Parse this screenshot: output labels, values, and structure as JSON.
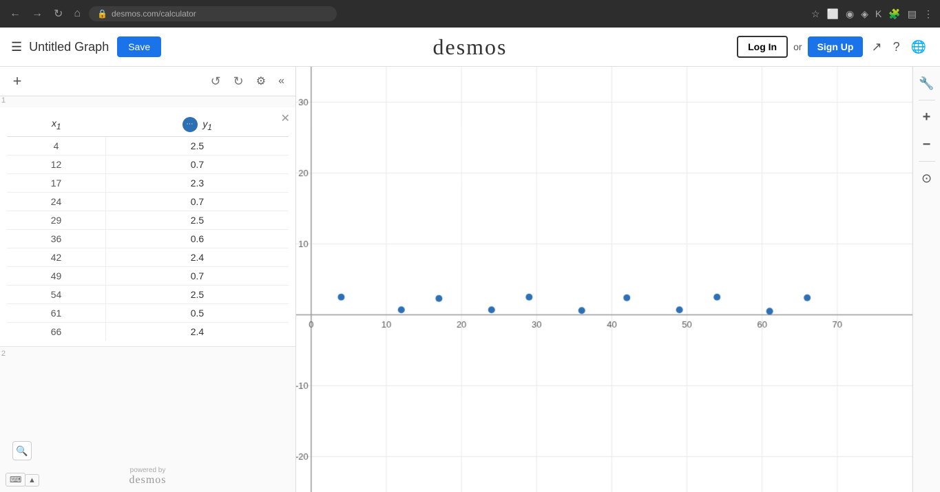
{
  "browser": {
    "url": "desmos.com/calculator",
    "back_icon": "←",
    "forward_icon": "→",
    "refresh_icon": "↻",
    "home_icon": "⌂"
  },
  "header": {
    "menu_icon": "☰",
    "title": "Untitled Graph",
    "save_label": "Save",
    "logo": "desmos",
    "login_label": "Log In",
    "or_text": "or",
    "signup_label": "Sign Up"
  },
  "sidebar": {
    "add_label": "+",
    "undo_label": "↺",
    "redo_label": "↻",
    "settings_label": "⚙",
    "collapse_label": "«",
    "table": {
      "col_x": "x₁",
      "col_y": "y₁",
      "rows": [
        {
          "x": "4",
          "y": "2.5"
        },
        {
          "x": "12",
          "y": "0.7"
        },
        {
          "x": "17",
          "y": "2.3"
        },
        {
          "x": "24",
          "y": "0.7"
        },
        {
          "x": "29",
          "y": "2.5"
        },
        {
          "x": "36",
          "y": "0.6"
        },
        {
          "x": "42",
          "y": "2.4"
        },
        {
          "x": "49",
          "y": "0.7"
        },
        {
          "x": "54",
          "y": "2.5"
        },
        {
          "x": "61",
          "y": "0.5"
        },
        {
          "x": "66",
          "y": "2.4"
        }
      ]
    },
    "keyboard_label": "⌨",
    "expand_label": "▲",
    "row_labels": [
      "1",
      "2"
    ],
    "powered_by": "powered by",
    "desmos_small": "desmos"
  },
  "graph": {
    "x_labels": [
      "0",
      "10",
      "20",
      "30",
      "40",
      "50",
      "60",
      "70"
    ],
    "y_labels": [
      "30",
      "20",
      "10",
      "-10",
      "-20"
    ],
    "data_points": [
      {
        "x": 4,
        "y": 2.5
      },
      {
        "x": 12,
        "y": 0.7
      },
      {
        "x": 17,
        "y": 2.3
      },
      {
        "x": 24,
        "y": 0.7
      },
      {
        "x": 29,
        "y": 2.5
      },
      {
        "x": 36,
        "y": 0.6
      },
      {
        "x": 42,
        "y": 2.4
      },
      {
        "x": 49,
        "y": 0.7
      },
      {
        "x": 54,
        "y": 2.5
      },
      {
        "x": 61,
        "y": 0.5
      },
      {
        "x": 66,
        "y": 2.4
      }
    ],
    "dot_color": "#2d70b3",
    "axis_color": "#555",
    "grid_color": "#e8e8e8"
  },
  "right_panel": {
    "wrench_icon": "🔧",
    "plus_icon": "+",
    "minus_icon": "−",
    "home_icon": "⊙"
  }
}
